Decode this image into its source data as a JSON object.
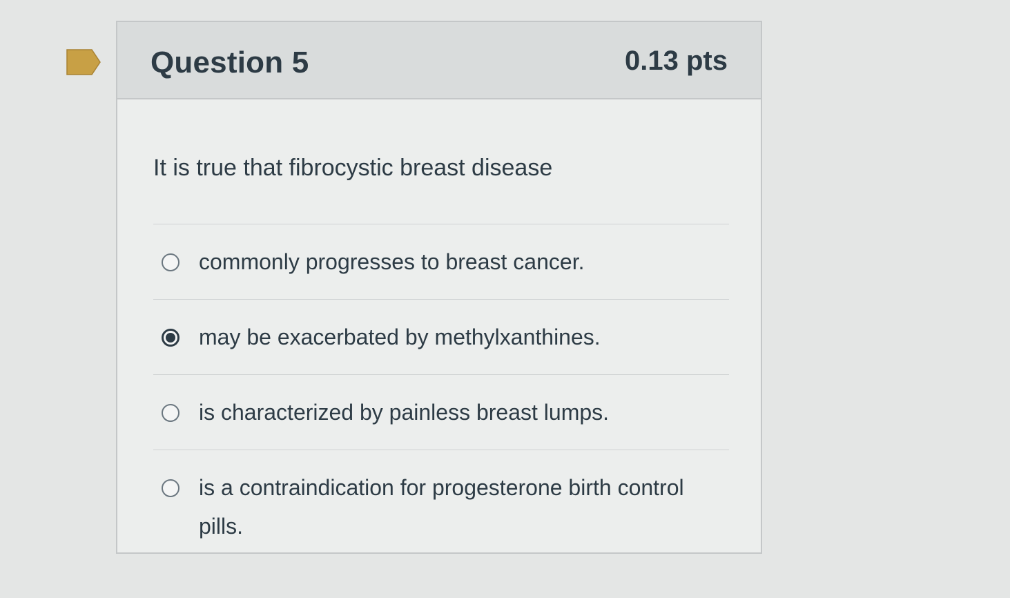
{
  "question": {
    "title": "Question 5",
    "points": "0.13 pts",
    "text": "It is true that fibrocystic breast disease",
    "flag_icon": "bookmark-flag-icon",
    "flag_color": "#c8a045"
  },
  "answers": [
    {
      "label": "commonly progresses to breast cancer.",
      "selected": false
    },
    {
      "label": "may be exacerbated by methylxanthines.",
      "selected": true
    },
    {
      "label": "is characterized by painless breast lumps.",
      "selected": false
    },
    {
      "label": "is a contraindication for progesterone birth control pills.",
      "selected": false
    }
  ]
}
